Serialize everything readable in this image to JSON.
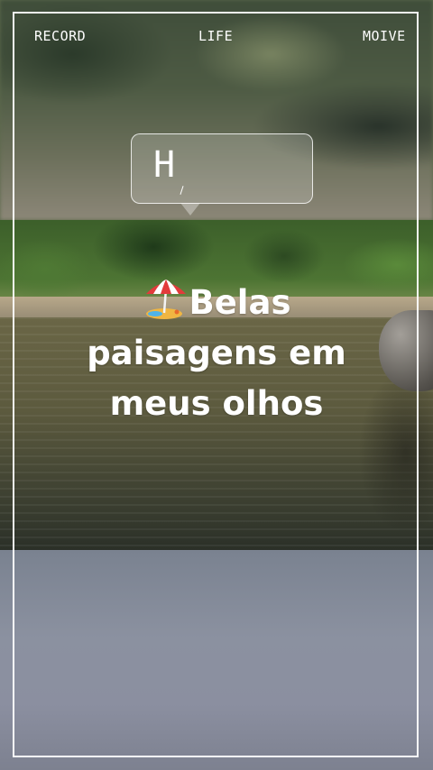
{
  "header": {
    "left_label": "RECORD",
    "center_label": "LIFE",
    "right_label": "MOIVE"
  },
  "bubble": {
    "text": "H"
  },
  "caption": {
    "icon": "beach-umbrella-icon",
    "line1": "Belas",
    "line2": "paisagens em",
    "line3": "meus olhos"
  },
  "colors": {
    "frame": "#ffffff",
    "text": "#ffffff"
  }
}
